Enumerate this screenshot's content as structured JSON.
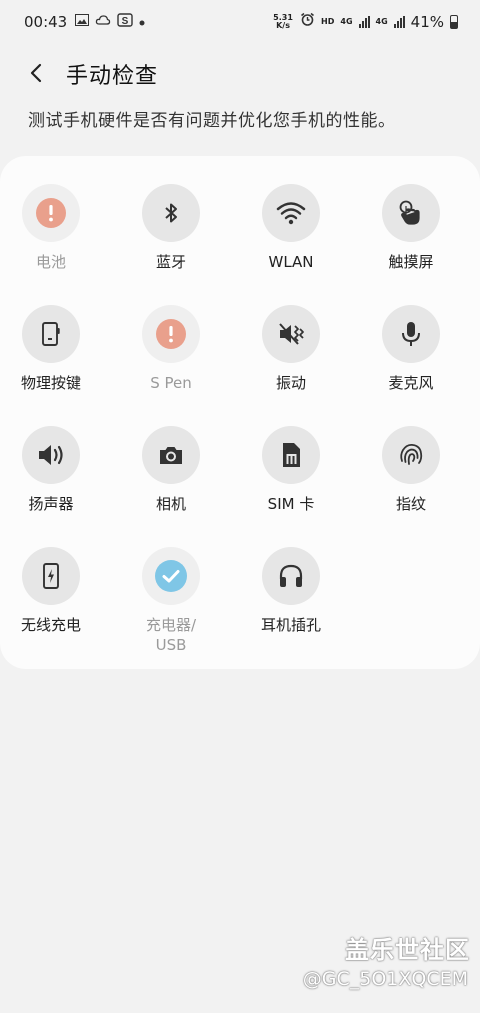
{
  "status_bar": {
    "time": "00:43",
    "net_speed_value": "5.31",
    "net_speed_unit": "K/s",
    "hd": "HD",
    "net1": "4G",
    "net2": "4G",
    "battery": "41%"
  },
  "header": {
    "title": "手动检查",
    "subtitle": "测试手机硬件是否有问题并优化您手机的性能。"
  },
  "checks": [
    {
      "label": "电池",
      "icon": "alert-icon",
      "status": "warning"
    },
    {
      "label": "蓝牙",
      "icon": "bluetooth-icon",
      "status": "normal"
    },
    {
      "label": "WLAN",
      "icon": "wifi-icon",
      "status": "normal"
    },
    {
      "label": "触摸屏",
      "icon": "touch-icon",
      "status": "normal"
    },
    {
      "label": "物理按键",
      "icon": "phone-key-icon",
      "status": "normal"
    },
    {
      "label": "S Pen",
      "icon": "alert-icon",
      "status": "warning"
    },
    {
      "label": "振动",
      "icon": "vibration-icon",
      "status": "normal"
    },
    {
      "label": "麦克风",
      "icon": "microphone-icon",
      "status": "normal"
    },
    {
      "label": "扬声器",
      "icon": "speaker-icon",
      "status": "normal"
    },
    {
      "label": "相机",
      "icon": "camera-icon",
      "status": "normal"
    },
    {
      "label": "SIM 卡",
      "icon": "sim-card-icon",
      "status": "normal"
    },
    {
      "label": "指纹",
      "icon": "fingerprint-icon",
      "status": "normal"
    },
    {
      "label": "无线充电",
      "icon": "wireless-charging-icon",
      "status": "normal"
    },
    {
      "label": "充电器/\nUSB",
      "icon": "check-icon",
      "status": "passed"
    },
    {
      "label": "耳机插孔",
      "icon": "headphones-icon",
      "status": "normal"
    }
  ],
  "colors": {
    "warning": "#e9a08c",
    "passed": "#7fc6e6",
    "icon": "#333333"
  },
  "watermark": {
    "brand": "盖乐世社区",
    "user": "@GC_5O1XQCEM"
  }
}
